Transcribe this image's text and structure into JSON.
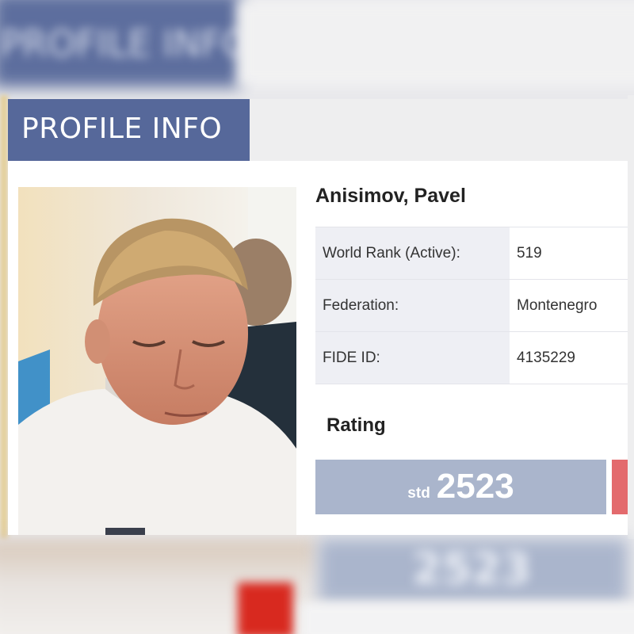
{
  "header": {
    "title": "PROFILE INFO"
  },
  "player": {
    "name": "Anisimov, Pavel",
    "photo_alt": "player-photo",
    "flag": "Montenegro flag"
  },
  "info": [
    {
      "label": "World Rank (Active):",
      "value": "519"
    },
    {
      "label": "Federation:",
      "value": "Montenegro"
    },
    {
      "label": "FIDE ID:",
      "value": "4135229"
    }
  ],
  "rating": {
    "heading": "Rating",
    "std_label": "std",
    "std_value": "2523"
  },
  "background": {
    "title_text": "PROFILE INFO",
    "rating_text": "2523"
  },
  "colors": {
    "header_blue": "#56689a",
    "rating_bg": "#aab5cc",
    "rating_red": "#e36a6d",
    "label_bg": "#eeeff4",
    "flag_red": "#d62b1f",
    "flag_border": "#d9b24a"
  }
}
